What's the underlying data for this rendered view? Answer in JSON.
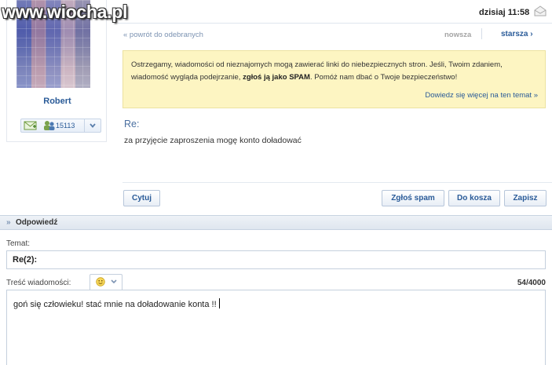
{
  "watermark": "www.wiocha.pl",
  "header": {
    "date_prefix": "dzisiaj",
    "time": "11:58"
  },
  "navigation": {
    "back_link": "« powrót do odebranych",
    "newer_label": "nowsza",
    "older_label": "starsza ›"
  },
  "sender": {
    "name": "Robert",
    "count": "15113"
  },
  "warning": {
    "text_before": "Ostrzegamy, wiadomości od nieznajomych mogą zawierać linki do niebezpiecznych stron. Jeśli, Twoim zdaniem, wiadomość wygląda podejrzanie, ",
    "text_bold": "zgłoś ją jako SPAM",
    "text_after": ". Pomóż nam dbać o Twoje bezpieczeństwo!",
    "more_link": "Dowiedz się więcej na ten temat »"
  },
  "message": {
    "subject": "Re:",
    "body": "za przyjęcie zaproszenia mogę konto doładować"
  },
  "actions": {
    "reply": "Cytuj",
    "spam": "Zgłoś spam",
    "trash": "Do kosza",
    "save": "Zapisz"
  },
  "reply": {
    "section_title": "Odpowiedź",
    "section_arrow": "»",
    "subject_label": "Temat:",
    "subject_value": "Re(2):",
    "content_label": "Treść wiadomości:",
    "char_count": "54/4000",
    "content_value": "goń się człowieku! stać mnie na doładowanie konta !!"
  },
  "colors": {
    "accent": "#2a5b98",
    "warning_bg": "#fdf5c2"
  }
}
